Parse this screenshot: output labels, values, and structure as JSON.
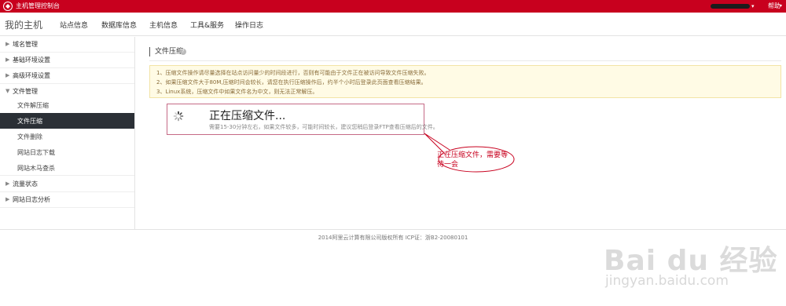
{
  "topbar": {
    "title": "主机管理控制台",
    "help": "帮助",
    "brand_color": "#c8001e"
  },
  "nav": {
    "brand": "我的主机",
    "items": [
      "站点信息",
      "数据库信息",
      "主机信息",
      "工具&服务",
      "操作日志"
    ]
  },
  "sidebar": {
    "sections": [
      {
        "label": "域名管理"
      },
      {
        "label": "基础环境设置"
      },
      {
        "label": "高级环境设置"
      },
      {
        "label": "文件管理"
      },
      {
        "label": "流量状态"
      },
      {
        "label": "网站日志分析"
      }
    ],
    "file_sub": [
      "文件解压缩",
      "文件压缩",
      "文件删除",
      "网站日志下载",
      "网站木马查杀"
    ],
    "active_sub": "文件压缩",
    "active_color": "#2b3036"
  },
  "main": {
    "section_title": "文件压缩",
    "notices": [
      "1、压缩文件操作请尽量选择在站点访问量少的时间段进行，否则有可能由于文件正在被访问导致文件压缩失败。",
      "2、如果压缩文件大于80M,压缩时间会较长，请您在执行压缩操作后，约半个小时后登录此页面查看压缩结果。",
      "3、Linux系统，压缩文件中如果文件名为中文，则无法正常解压。"
    ],
    "progress_title": "正在压缩文件...",
    "progress_sub": "需要15-30分钟左右，如果文件较多，可能时间较长，建议您稍后登录FTP查看压缩后的文件。"
  },
  "callout": {
    "text": "正在压缩文件，需要等待一会",
    "color": "#c8001e"
  },
  "footer": {
    "text": "2014阿里云计算有限公司版权所有 ICP证：浙B2-20080101"
  },
  "watermark": {
    "brand": "Bai du 经验",
    "url": "jingyan.baidu.com"
  }
}
